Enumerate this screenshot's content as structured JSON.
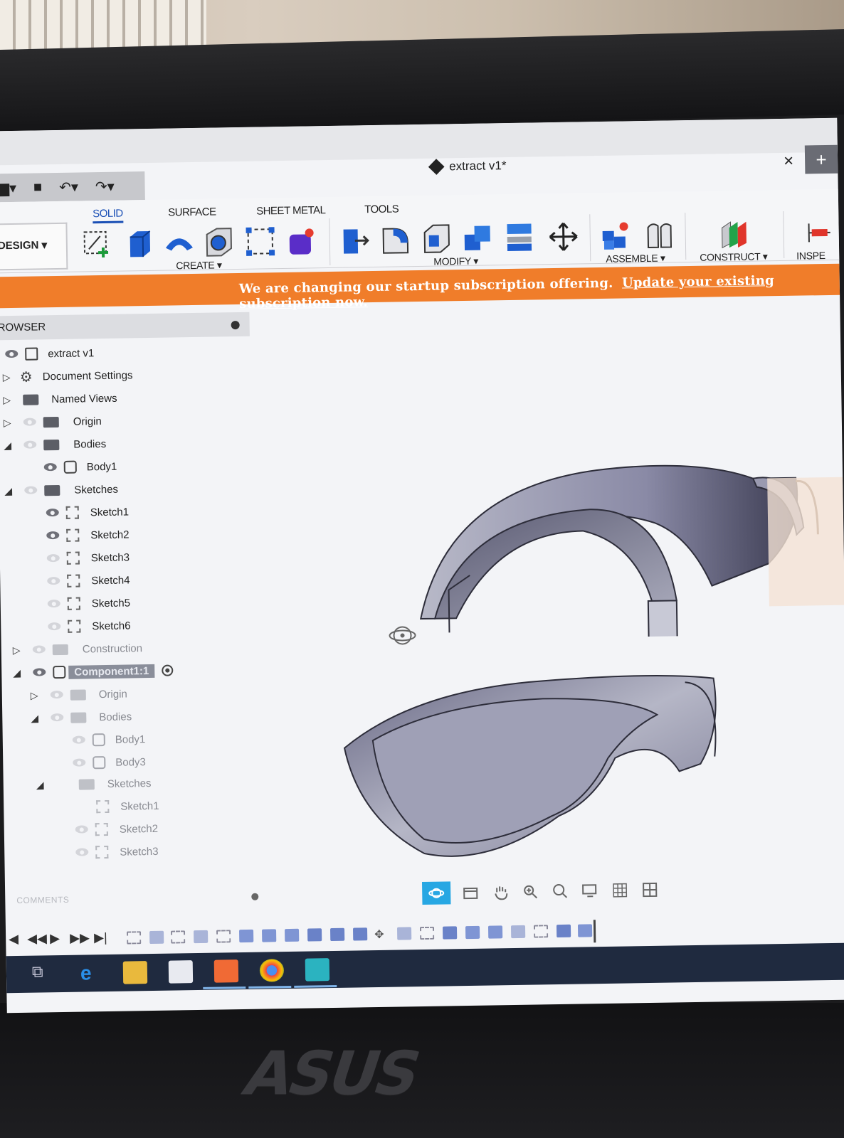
{
  "app": {
    "document_title": "extract v1*",
    "close_label": "×",
    "new_tab_label": "+"
  },
  "quick_tools": {
    "file_icon": "file-icon",
    "save_icon": "save-icon",
    "undo_icon": "undo-icon",
    "redo_icon": "redo-icon"
  },
  "workspace": {
    "label": "DESIGN ▾"
  },
  "tabs": [
    {
      "label": "SOLID",
      "active": true
    },
    {
      "label": "SURFACE",
      "active": false
    },
    {
      "label": "SHEET METAL",
      "active": false
    },
    {
      "label": "TOOLS",
      "active": false
    }
  ],
  "groups": {
    "create": "CREATE ▾",
    "modify": "MODIFY ▾",
    "assemble": "ASSEMBLE ▾",
    "construct": "CONSTRUCT ▾",
    "inspect": "INSPE"
  },
  "banner": {
    "message": "We are changing our startup subscription offering.",
    "link": "Update your existing subscription now."
  },
  "browser": {
    "title": "ROWSER",
    "items": [
      {
        "label": "extract v1"
      },
      {
        "label": "Document Settings"
      },
      {
        "label": "Named Views"
      },
      {
        "label": "Origin"
      },
      {
        "label": "Bodies"
      },
      {
        "label": "Body1"
      },
      {
        "label": "Sketches"
      },
      {
        "label": "Sketch1"
      },
      {
        "label": "Sketch2"
      },
      {
        "label": "Sketch3"
      },
      {
        "label": "Sketch4"
      },
      {
        "label": "Sketch5"
      },
      {
        "label": "Sketch6"
      },
      {
        "label": "Construction"
      },
      {
        "label": "Component1:1"
      },
      {
        "label": "Origin"
      },
      {
        "label": "Bodies"
      },
      {
        "label": "Body1"
      },
      {
        "label": "Body3"
      },
      {
        "label": "Sketches"
      },
      {
        "label": "Sketch1"
      },
      {
        "label": "Sketch2"
      },
      {
        "label": "Sketch3"
      }
    ]
  },
  "comments": {
    "label": "COMMENTS"
  },
  "colors": {
    "accent": "#1a4fb5",
    "banner": "#f07d2a",
    "selection": "#8a8e9a",
    "nav_active": "#27a7e3",
    "taskbar": "#1f2a3f"
  }
}
